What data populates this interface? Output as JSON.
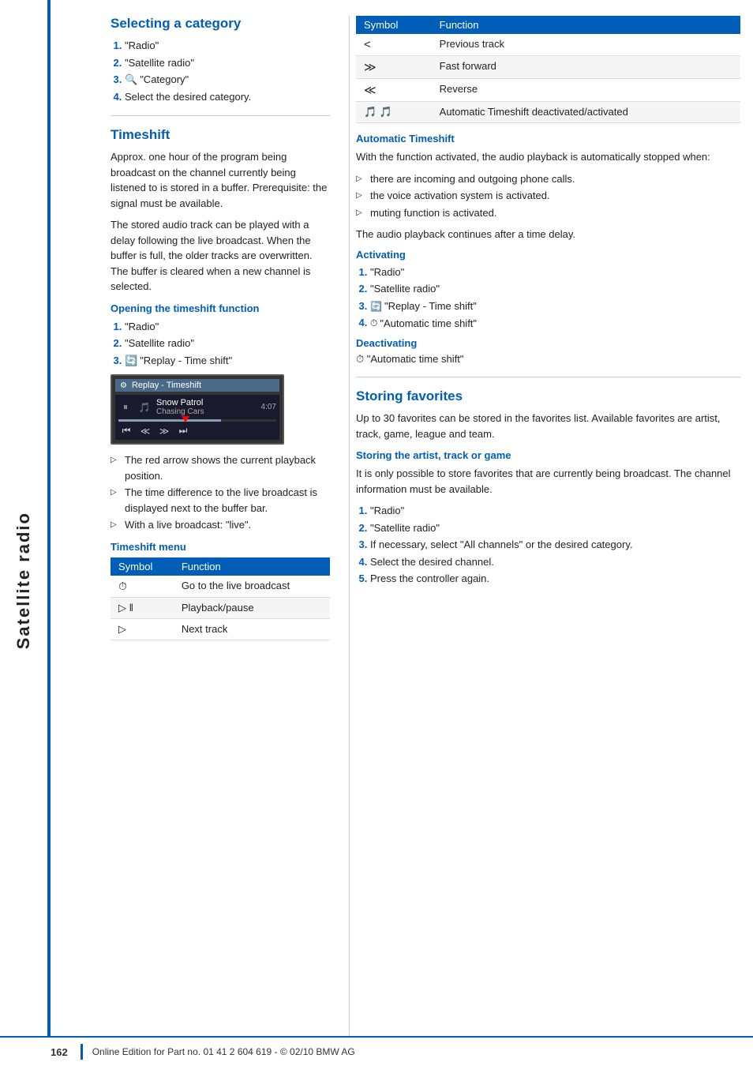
{
  "sidebar": {
    "label": "Satellite radio"
  },
  "page": {
    "number": "162",
    "footer": "Online Edition for Part no. 01 41 2 604 619 - © 02/10 BMW AG"
  },
  "selecting_category": {
    "title": "Selecting a category",
    "steps": [
      {
        "num": "1.",
        "text": "\"Radio\""
      },
      {
        "num": "2.",
        "text": "\"Satellite radio\""
      },
      {
        "num": "3.",
        "icon": "category-icon",
        "text": "\"Category\""
      },
      {
        "num": "4.",
        "text": "Select the desired category."
      }
    ]
  },
  "timeshift": {
    "title": "Timeshift",
    "body1": "Approx. one hour of the program being broadcast on the channel currently being listened to is stored in a buffer. Prerequisite: the signal must be available.",
    "body2": "The stored audio track can be played with a delay following the live broadcast. When the buffer is full, the older tracks are overwritten. The buffer is cleared when a new channel is selected.",
    "opening": {
      "title": "Opening the timeshift function",
      "steps": [
        {
          "num": "1.",
          "text": "\"Radio\""
        },
        {
          "num": "2.",
          "text": "\"Satellite radio\""
        },
        {
          "num": "3.",
          "icon": "replay-icon",
          "text": "\"Replay - Time shift\""
        }
      ]
    },
    "screenshot": {
      "titlebar": "Replay - Timeshift",
      "track1": "Snow Patrol",
      "track2": "Chasing Cars",
      "time": "4:07"
    },
    "bullets": [
      "The red arrow shows the current playback position.",
      "The time difference to the live broadcast is displayed next to the buffer bar.",
      "With a live broadcast: \"live\"."
    ],
    "menu": {
      "title": "Timeshift menu",
      "symbol_col": "Symbol",
      "function_col": "Function",
      "rows": [
        {
          "symbol": "⏱",
          "function": "Go to the live broadcast"
        },
        {
          "symbol": "▷ ‖",
          "function": "Playback/pause"
        },
        {
          "symbol": "▷",
          "function": "Next track"
        }
      ]
    }
  },
  "symbol_table": {
    "symbol_col": "Symbol",
    "function_col": "Function",
    "rows": [
      {
        "symbol": "<",
        "function": "Previous track"
      },
      {
        "symbol": "≫",
        "function": "Fast forward"
      },
      {
        "symbol": "≪",
        "function": "Reverse"
      },
      {
        "symbol": "🎵 🎵",
        "function": "Automatic Timeshift deactivated/activated"
      }
    ]
  },
  "automatic_timeshift": {
    "title": "Automatic Timeshift",
    "body": "With the function activated, the audio playback is automatically stopped when:",
    "bullets": [
      "there are incoming and outgoing phone calls.",
      "the voice activation system is activated.",
      "muting function is activated."
    ],
    "body2": "The audio playback continues after a time delay.",
    "activating": {
      "title": "Activating",
      "steps": [
        {
          "num": "1.",
          "text": "\"Radio\""
        },
        {
          "num": "2.",
          "text": "\"Satellite radio\""
        },
        {
          "num": "3.",
          "icon": "replay-icon",
          "text": "\"Replay - Time shift\""
        },
        {
          "num": "4.",
          "icon": "auto-icon",
          "text": "\"Automatic time shift\""
        }
      ]
    },
    "deactivating": {
      "title": "Deactivating",
      "text": "\"Automatic time shift\""
    }
  },
  "storing_favorites": {
    "title": "Storing favorites",
    "body": "Up to 30 favorites can be stored in the favorites list. Available favorites are artist, track, game, league and team.",
    "storing_artist": {
      "title": "Storing the artist, track or game",
      "body": "It is only possible to store favorites that are currently being broadcast. The channel information must be available.",
      "steps": [
        {
          "num": "1.",
          "text": "\"Radio\""
        },
        {
          "num": "2.",
          "text": "\"Satellite radio\""
        },
        {
          "num": "3.",
          "text": "If necessary, select \"All channels\" or the desired category."
        },
        {
          "num": "4.",
          "text": "Select the desired channel."
        },
        {
          "num": "5.",
          "text": "Press the controller again."
        }
      ]
    }
  }
}
